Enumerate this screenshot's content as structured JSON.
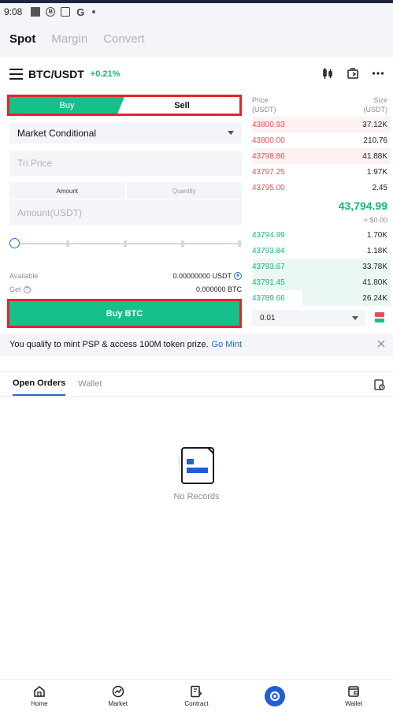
{
  "status_bar": {
    "time": "9:08"
  },
  "mode_tabs": [
    {
      "label": "Spot",
      "active": true
    },
    {
      "label": "Margin",
      "active": false
    },
    {
      "label": "Convert",
      "active": false
    }
  ],
  "pair": {
    "name": "BTC/USDT",
    "change": "+0.21%"
  },
  "order_form": {
    "buy_label": "Buy",
    "sell_label": "Sell",
    "side_selected": "Buy",
    "order_type": "Market Conditional",
    "trigger_price_placeholder": "Tri.Price",
    "amount_tab": "Amount",
    "quantity_tab": "Quantity",
    "amount_placeholder": "Amount(USDT)",
    "slider_percent": 0,
    "available_label": "Available",
    "available_value": "0.00000000 USDT",
    "get_label": "Get",
    "get_value": "0.000000 BTC",
    "submit_label": "Buy BTC"
  },
  "order_book": {
    "price_header": "Price",
    "price_unit": "(USDT)",
    "size_header": "Size",
    "size_unit": "(USDT)",
    "asks": [
      {
        "price": "43800.93",
        "size": "37.12K",
        "depth": 0.97
      },
      {
        "price": "43800.00",
        "size": "210.76",
        "depth": 0.0
      },
      {
        "price": "43798.86",
        "size": "41.88K",
        "depth": 0.97
      },
      {
        "price": "43797.25",
        "size": "1.97K",
        "depth": 0.0
      },
      {
        "price": "43795.00",
        "size": "2.45",
        "depth": 0.0
      }
    ],
    "mid_price": "43,794.99",
    "mid_usd": "≈ $0.00",
    "bids": [
      {
        "price": "43794.99",
        "size": "1.70K",
        "depth": 0.0
      },
      {
        "price": "43793.84",
        "size": "1.18K",
        "depth": 0.0
      },
      {
        "price": "43793.67",
        "size": "33.78K",
        "depth": 0.97
      },
      {
        "price": "43791.45",
        "size": "41.80K",
        "depth": 0.97
      },
      {
        "price": "43789.66",
        "size": "26.24K",
        "depth": 0.62
      }
    ],
    "precision": "0.01"
  },
  "promo": {
    "text": "You qualify to mint PSP & access 100M token prize.",
    "link": "Go Mint"
  },
  "orders": {
    "tabs": [
      {
        "label": "Open Orders",
        "active": true
      },
      {
        "label": "Wallet",
        "active": false
      }
    ],
    "empty_text": "No Records"
  },
  "bottom_nav": [
    {
      "label": "Home",
      "icon": "home-icon"
    },
    {
      "label": "Market",
      "icon": "market-icon"
    },
    {
      "label": "Contract",
      "icon": "contract-icon"
    },
    {
      "label": "",
      "icon": "center-logo-icon"
    },
    {
      "label": "Wallet",
      "icon": "wallet-icon"
    }
  ],
  "colors": {
    "buy_green": "#17c08a",
    "sell_red": "#e84f58",
    "accent_blue": "#1f6bd6",
    "highlight_red": "#e0252b"
  }
}
